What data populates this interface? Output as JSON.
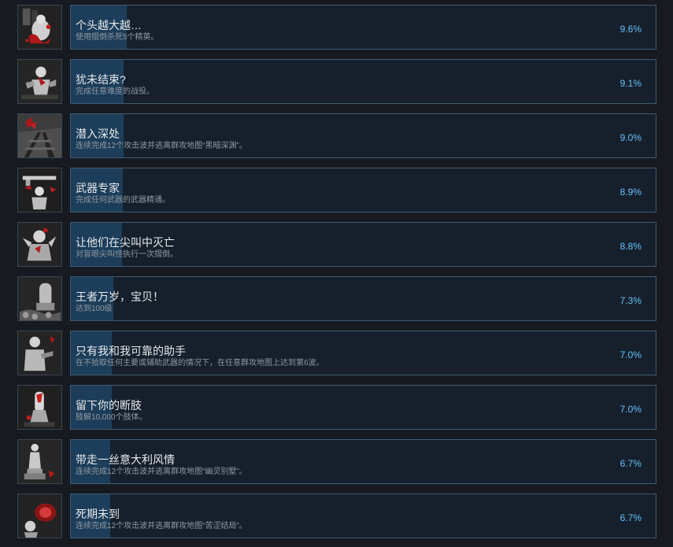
{
  "achievements": [
    {
      "title": "个头越大越…",
      "description": "使用摺倒杀死5个精英。",
      "percent": "9.6%",
      "percent_value": 9.6,
      "icon": "zombie-splatter-icon"
    },
    {
      "title": "犹未结束?",
      "description": "完成任意难度的战役。",
      "percent": "9.1%",
      "percent_value": 9.1,
      "icon": "survivor-fighting-icon"
    },
    {
      "title": "潜入深处",
      "description": "连续完成12个攻击波并逃离群攻地图“黑暗深渊”。",
      "percent": "9.0%",
      "percent_value": 9.0,
      "icon": "dark-tracks-icon"
    },
    {
      "title": "武器专家",
      "description": "完成任何武器的武器精通。",
      "percent": "8.9%",
      "percent_value": 8.9,
      "icon": "weapon-expert-icon"
    },
    {
      "title": "让他们在尖叫中灭亡",
      "description": "对盲眼尖叫怪执行一次摺倒。",
      "percent": "8.8%",
      "percent_value": 8.8,
      "icon": "screamer-icon"
    },
    {
      "title": "王者万岁，宝贝！",
      "description": "达到100级",
      "percent": "7.3%",
      "percent_value": 7.3,
      "icon": "level-100-icon"
    },
    {
      "title": "只有我和我可靠的助手",
      "description": "在不拾取任何主要或辅助武器的情况下，在任意群攻地图上达到第6波。",
      "percent": "7.0%",
      "percent_value": 7.0,
      "icon": "wave-6-icon"
    },
    {
      "title": "留下你的断肢",
      "description": "肢解10,000个肢体。",
      "percent": "7.0%",
      "percent_value": 7.0,
      "icon": "severed-limb-icon"
    },
    {
      "title": "带走一丝意大利风情",
      "description": "连续完成12个攻击波并逃离群攻地图“幽灵别墅”。",
      "percent": "6.7%",
      "percent_value": 6.7,
      "icon": "statue-12-icon"
    },
    {
      "title": "死期未到",
      "description": "连续完成12个攻击波并逃离群攻地图“苦涩结局”。",
      "percent": "6.7%",
      "percent_value": 6.7,
      "icon": "bitter-end-12-icon"
    }
  ],
  "colors": {
    "accent": "#66c0f4",
    "fill": "#1d3e5a",
    "panel": "#16202d",
    "border": "#3e5a72"
  }
}
